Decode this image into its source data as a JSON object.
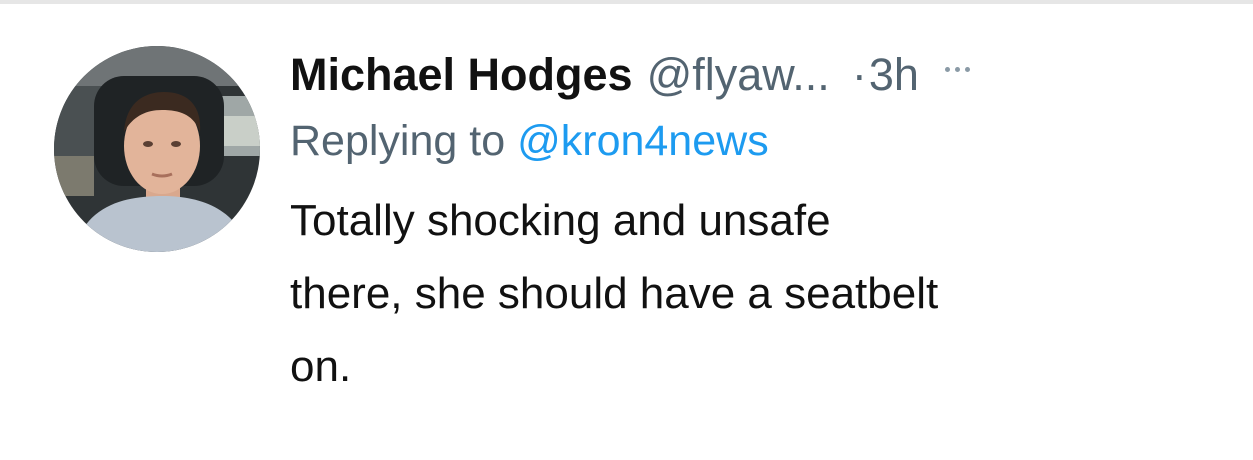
{
  "tweet": {
    "display_name": "Michael Hodges",
    "handle": "@flyaw...",
    "separator": "·",
    "timestamp": "3h",
    "more_icon": "more-horizontal-icon",
    "reply_prefix": "Replying to",
    "reply_handle": "@kron4news",
    "text_lines": [
      "Totally shocking and unsafe",
      "there, she should have a seatbelt",
      "on."
    ]
  },
  "colors": {
    "name": "#111111",
    "muted": "#536471",
    "link": "#1d9bf0",
    "background": "#ffffff"
  }
}
